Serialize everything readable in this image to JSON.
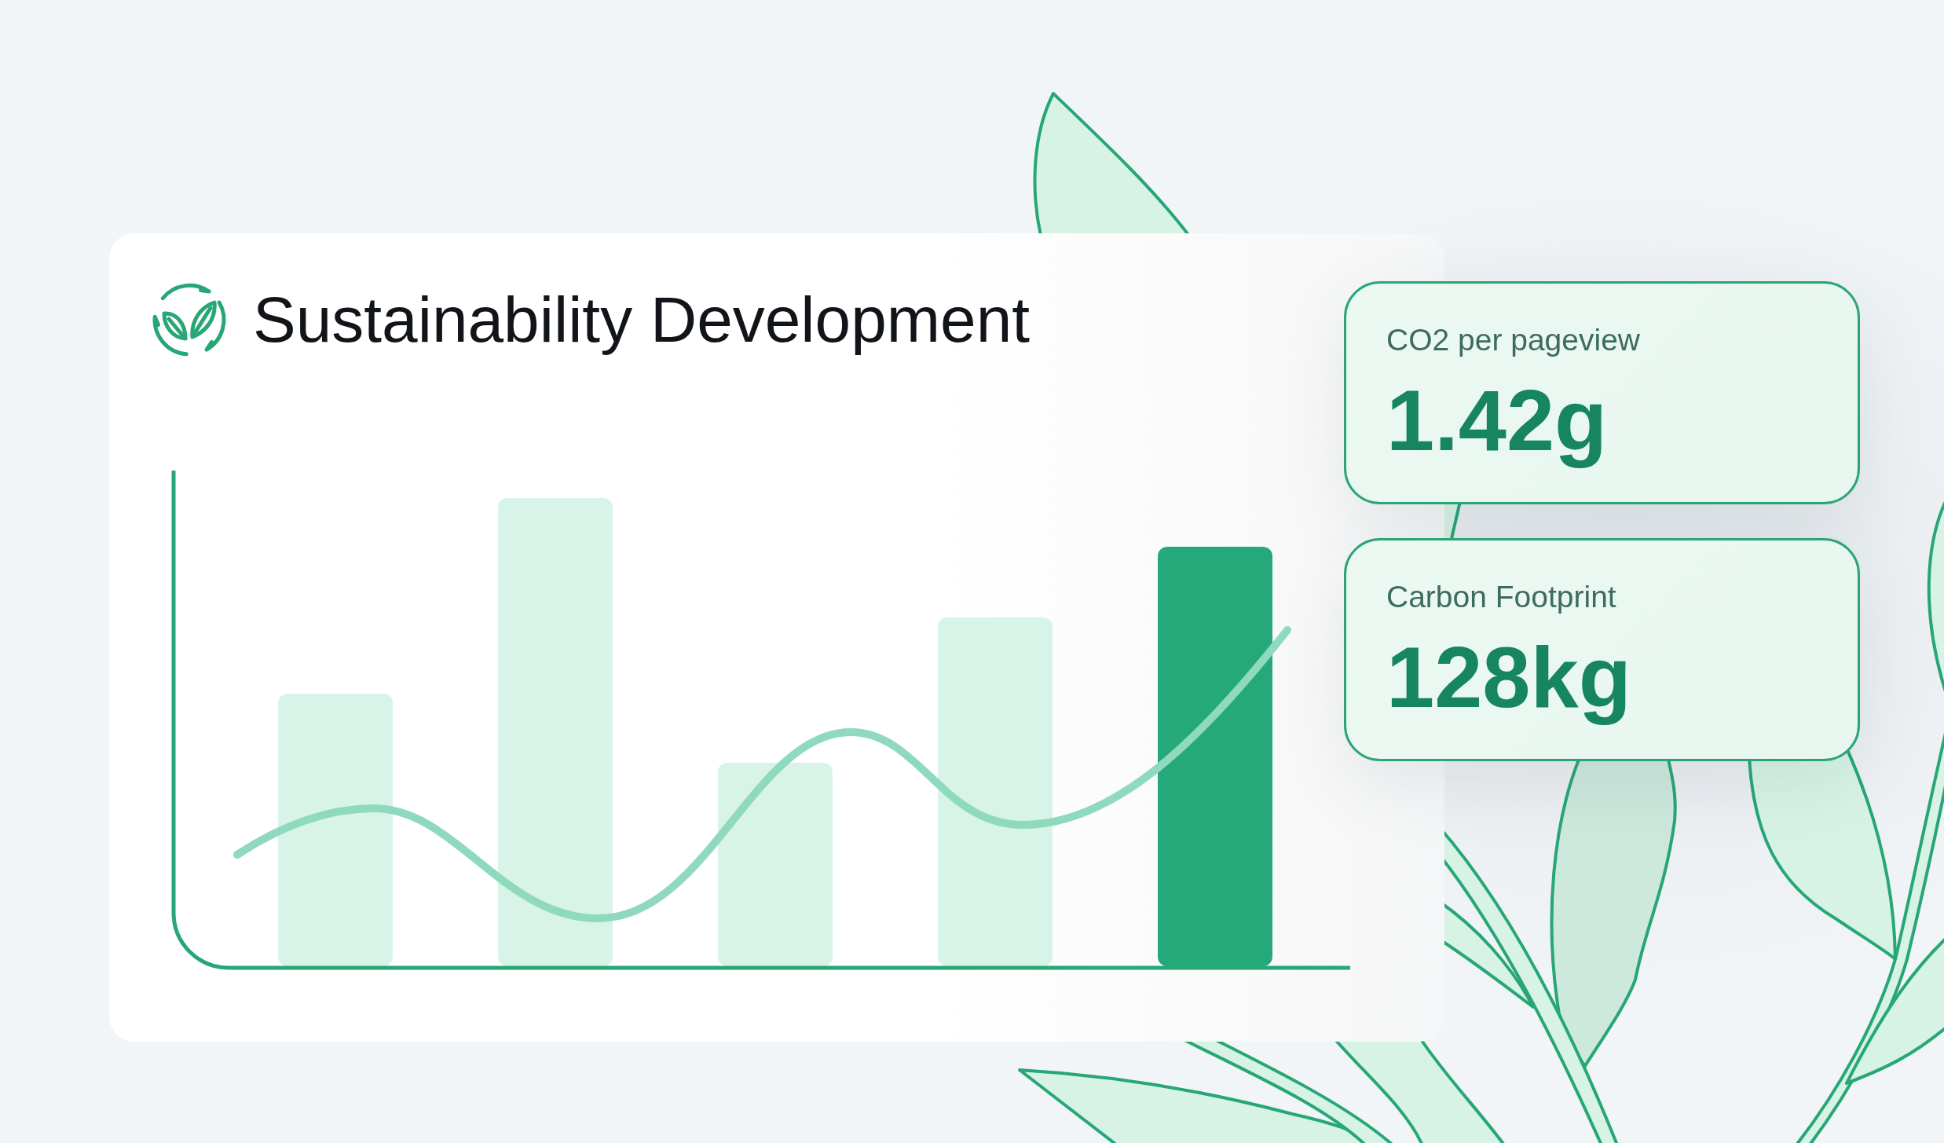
{
  "card": {
    "title": "Sustainability Development",
    "chart": {
      "bars": [
        {
          "highlighted": false
        },
        {
          "highlighted": false
        },
        {
          "highlighted": false
        },
        {
          "highlighted": false
        },
        {
          "highlighted": true
        }
      ]
    }
  },
  "stats": [
    {
      "label": "CO2 per pageview",
      "value": "1.42g"
    },
    {
      "label": "Carbon Footprint",
      "value": "128kg"
    }
  ]
}
